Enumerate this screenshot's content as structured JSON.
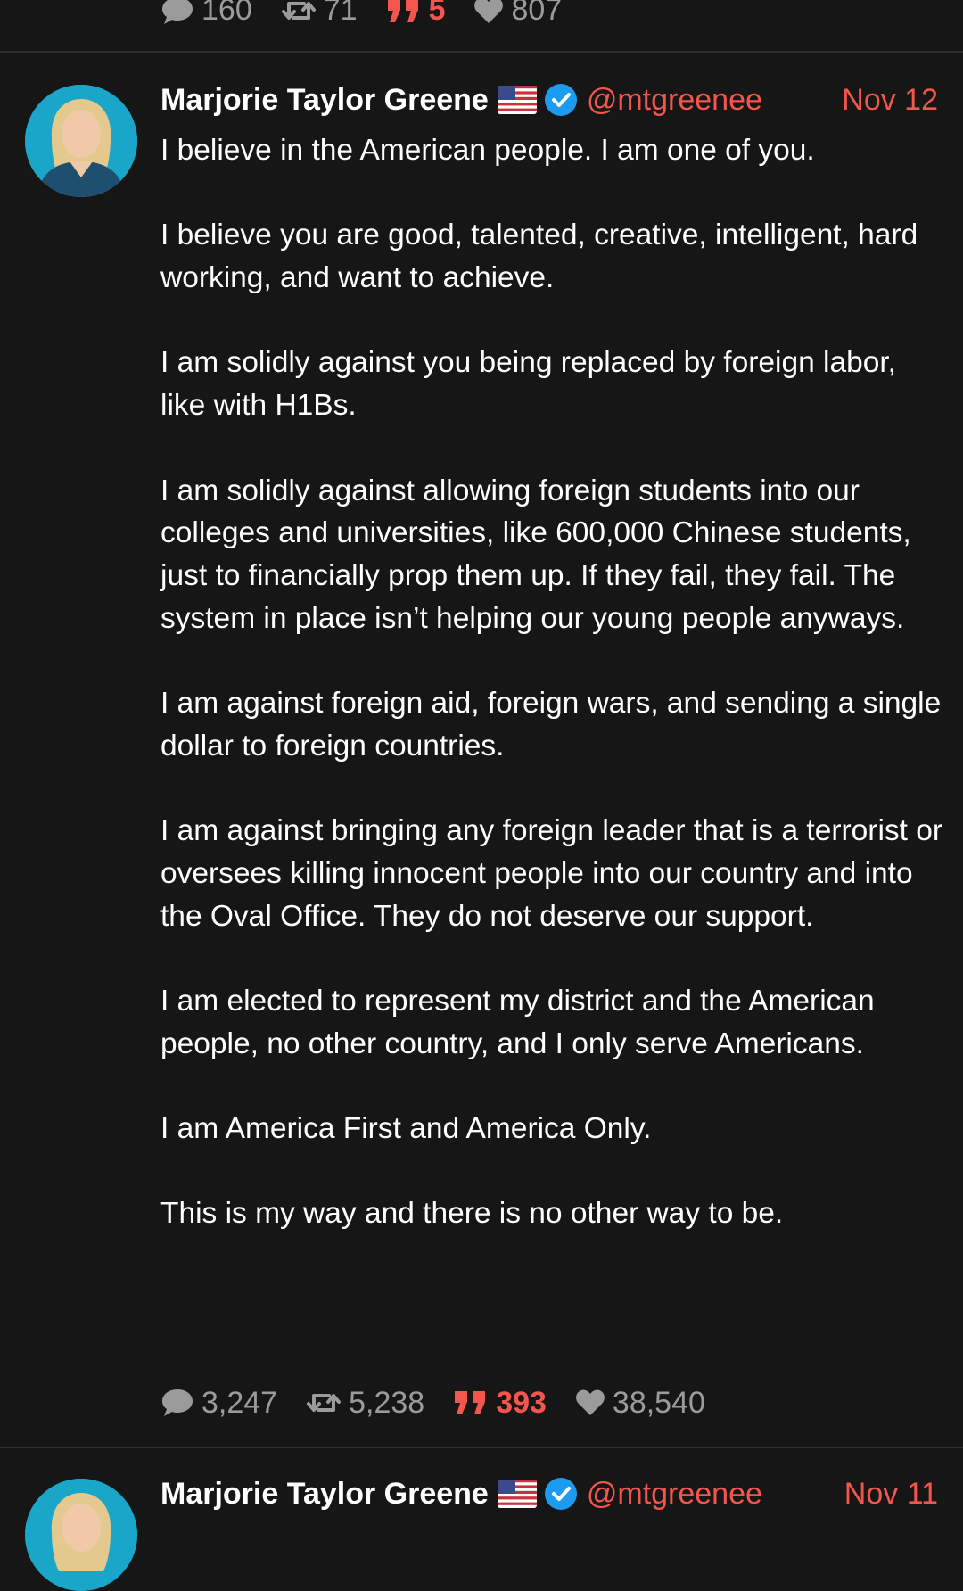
{
  "prev_post": {
    "stats": {
      "replies": "160",
      "reposts": "71",
      "quotes": "5",
      "likes": "807"
    }
  },
  "post": {
    "author": "Marjorie Taylor Greene",
    "handle": "@mtgreenee",
    "date": "Nov 12",
    "paragraphs": [
      "I believe in the American people. I am one of you.",
      "I believe you are good, talented, creative, intelligent, hard working, and want to achieve.",
      "I am solidly against you being replaced by foreign labor, like with H1Bs.",
      "I am solidly against allowing foreign students into our colleges and universities, like 600,000 Chinese students, just to financially prop them up. If they fail, they fail. The system in place isn’t helping our young people anyways.",
      "I am against foreign aid, foreign wars, and sending a single dollar to foreign countries.",
      "I am against bringing any foreign leader that is a terrorist or oversees killing innocent people into our country and into the Oval Office. They do not deserve our support.",
      "I am elected to represent my district and the American people, no other country, and I only serve Americans.",
      "I am America First and America Only.",
      "This is my way and there is no other way to be."
    ],
    "stats": {
      "replies": "3,247",
      "reposts": "5,238",
      "quotes": "393",
      "likes": "38,540"
    }
  },
  "next_post": {
    "author": "Marjorie Taylor Greene",
    "handle": "@mtgreenee",
    "date": "Nov 11"
  },
  "colors": {
    "background": "#161616",
    "accent": "#f2564c",
    "muted": "#9b9b9b",
    "verified": "#1d9bf0"
  },
  "icons": {
    "reply": "speech-bubble-icon",
    "repost": "repost-icon",
    "quote": "quote-icon",
    "like": "heart-icon",
    "verified": "verified-badge-icon",
    "flag": "us-flag-icon"
  }
}
